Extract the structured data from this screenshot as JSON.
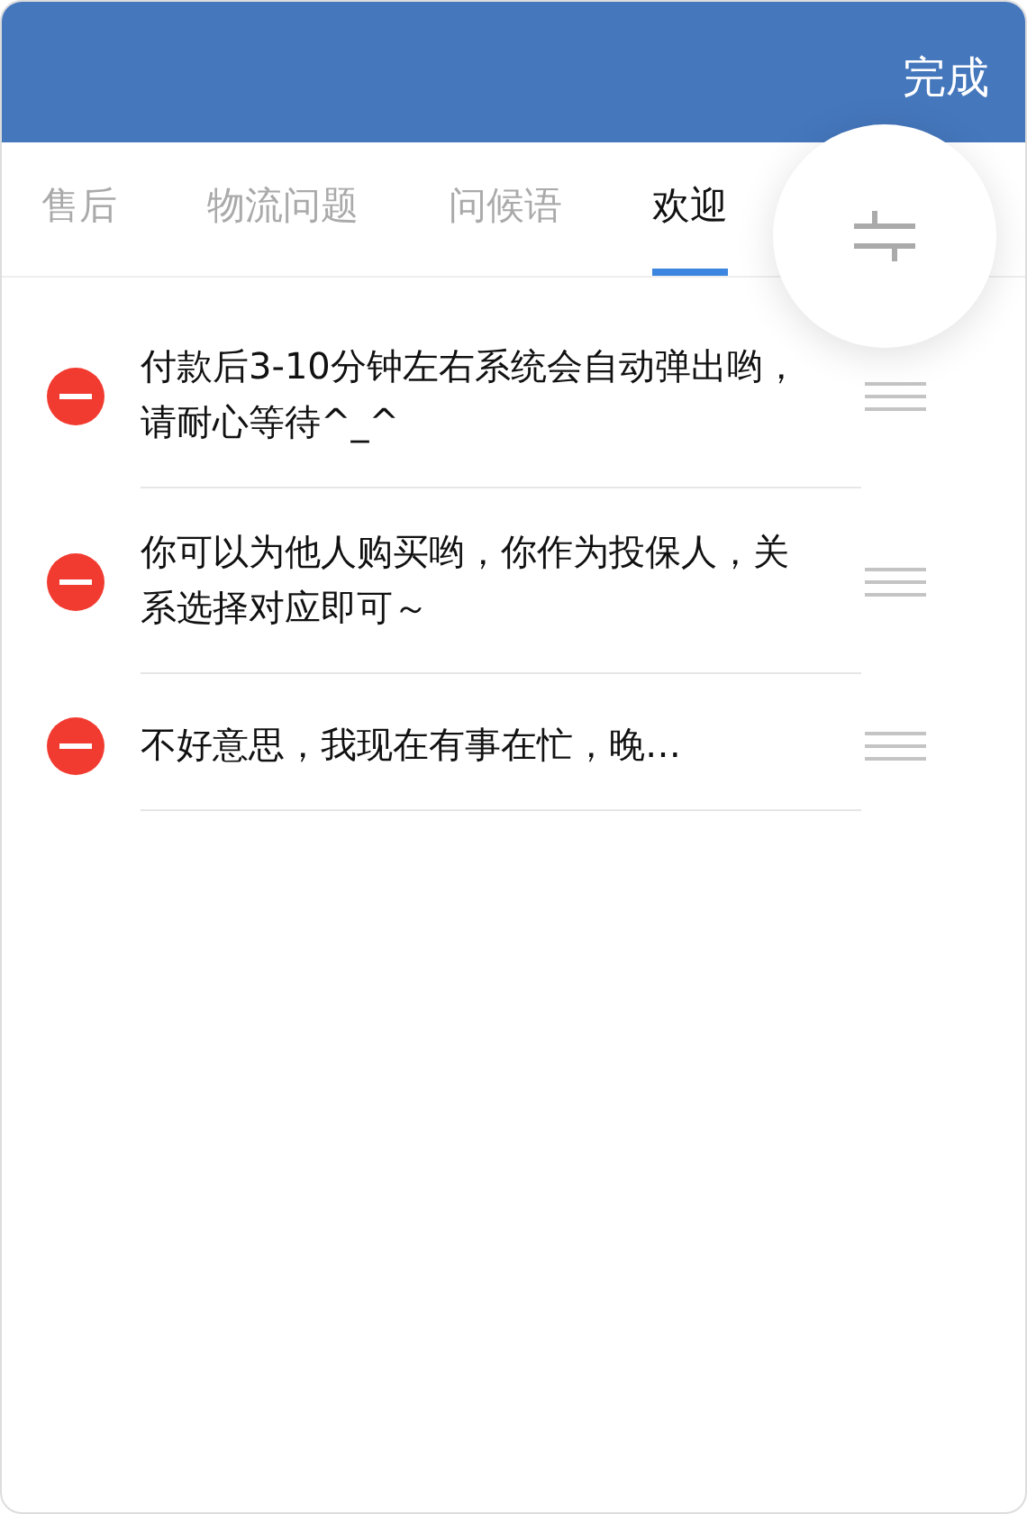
{
  "header": {
    "done_button": "完成"
  },
  "tabs": [
    {
      "label": "售后",
      "selected": false
    },
    {
      "label": "物流问题",
      "selected": false
    },
    {
      "label": "问候语",
      "selected": false
    },
    {
      "label": "欢迎",
      "selected": true
    }
  ],
  "rows": [
    {
      "text": "付款后3-10分钟左右系统会自动弹出哟，请耐心等待^_^"
    },
    {
      "text": "你可以为他人购买哟，你作为投保人，关系选择对应即可～"
    },
    {
      "text": "不好意思，我现在有事在忙，晚…"
    }
  ]
}
